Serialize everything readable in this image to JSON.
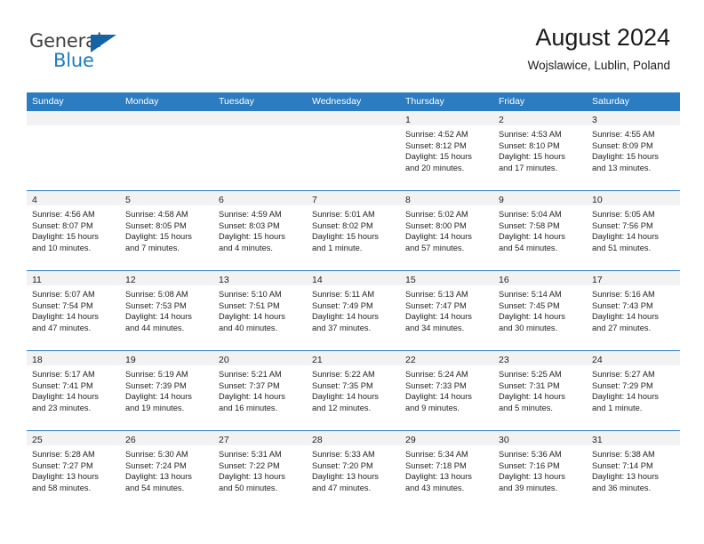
{
  "brand": {
    "name_top": "General",
    "name_bottom": "Blue",
    "triangle_icon": "blue-triangle-icon",
    "color_top": "#3f3f3f",
    "color_bottom": "#1b7bc1"
  },
  "header": {
    "title": "August 2024",
    "subtitle": "Wojslawice, Lublin, Poland"
  },
  "theme": {
    "header_blue": "#2b7cc0",
    "daynum_band": "#f2f2f2",
    "text": "#231f20"
  },
  "weekdays": [
    "Sunday",
    "Monday",
    "Tuesday",
    "Wednesday",
    "Thursday",
    "Friday",
    "Saturday"
  ],
  "weeks": [
    [
      {
        "day": "",
        "lines": []
      },
      {
        "day": "",
        "lines": []
      },
      {
        "day": "",
        "lines": []
      },
      {
        "day": "",
        "lines": []
      },
      {
        "day": "1",
        "lines": [
          "Sunrise: 4:52 AM",
          "Sunset: 8:12 PM",
          "Daylight: 15 hours",
          "and 20 minutes."
        ]
      },
      {
        "day": "2",
        "lines": [
          "Sunrise: 4:53 AM",
          "Sunset: 8:10 PM",
          "Daylight: 15 hours",
          "and 17 minutes."
        ]
      },
      {
        "day": "3",
        "lines": [
          "Sunrise: 4:55 AM",
          "Sunset: 8:09 PM",
          "Daylight: 15 hours",
          "and 13 minutes."
        ]
      }
    ],
    [
      {
        "day": "4",
        "lines": [
          "Sunrise: 4:56 AM",
          "Sunset: 8:07 PM",
          "Daylight: 15 hours",
          "and 10 minutes."
        ]
      },
      {
        "day": "5",
        "lines": [
          "Sunrise: 4:58 AM",
          "Sunset: 8:05 PM",
          "Daylight: 15 hours",
          "and 7 minutes."
        ]
      },
      {
        "day": "6",
        "lines": [
          "Sunrise: 4:59 AM",
          "Sunset: 8:03 PM",
          "Daylight: 15 hours",
          "and 4 minutes."
        ]
      },
      {
        "day": "7",
        "lines": [
          "Sunrise: 5:01 AM",
          "Sunset: 8:02 PM",
          "Daylight: 15 hours",
          "and 1 minute."
        ]
      },
      {
        "day": "8",
        "lines": [
          "Sunrise: 5:02 AM",
          "Sunset: 8:00 PM",
          "Daylight: 14 hours",
          "and 57 minutes."
        ]
      },
      {
        "day": "9",
        "lines": [
          "Sunrise: 5:04 AM",
          "Sunset: 7:58 PM",
          "Daylight: 14 hours",
          "and 54 minutes."
        ]
      },
      {
        "day": "10",
        "lines": [
          "Sunrise: 5:05 AM",
          "Sunset: 7:56 PM",
          "Daylight: 14 hours",
          "and 51 minutes."
        ]
      }
    ],
    [
      {
        "day": "11",
        "lines": [
          "Sunrise: 5:07 AM",
          "Sunset: 7:54 PM",
          "Daylight: 14 hours",
          "and 47 minutes."
        ]
      },
      {
        "day": "12",
        "lines": [
          "Sunrise: 5:08 AM",
          "Sunset: 7:53 PM",
          "Daylight: 14 hours",
          "and 44 minutes."
        ]
      },
      {
        "day": "13",
        "lines": [
          "Sunrise: 5:10 AM",
          "Sunset: 7:51 PM",
          "Daylight: 14 hours",
          "and 40 minutes."
        ]
      },
      {
        "day": "14",
        "lines": [
          "Sunrise: 5:11 AM",
          "Sunset: 7:49 PM",
          "Daylight: 14 hours",
          "and 37 minutes."
        ]
      },
      {
        "day": "15",
        "lines": [
          "Sunrise: 5:13 AM",
          "Sunset: 7:47 PM",
          "Daylight: 14 hours",
          "and 34 minutes."
        ]
      },
      {
        "day": "16",
        "lines": [
          "Sunrise: 5:14 AM",
          "Sunset: 7:45 PM",
          "Daylight: 14 hours",
          "and 30 minutes."
        ]
      },
      {
        "day": "17",
        "lines": [
          "Sunrise: 5:16 AM",
          "Sunset: 7:43 PM",
          "Daylight: 14 hours",
          "and 27 minutes."
        ]
      }
    ],
    [
      {
        "day": "18",
        "lines": [
          "Sunrise: 5:17 AM",
          "Sunset: 7:41 PM",
          "Daylight: 14 hours",
          "and 23 minutes."
        ]
      },
      {
        "day": "19",
        "lines": [
          "Sunrise: 5:19 AM",
          "Sunset: 7:39 PM",
          "Daylight: 14 hours",
          "and 19 minutes."
        ]
      },
      {
        "day": "20",
        "lines": [
          "Sunrise: 5:21 AM",
          "Sunset: 7:37 PM",
          "Daylight: 14 hours",
          "and 16 minutes."
        ]
      },
      {
        "day": "21",
        "lines": [
          "Sunrise: 5:22 AM",
          "Sunset: 7:35 PM",
          "Daylight: 14 hours",
          "and 12 minutes."
        ]
      },
      {
        "day": "22",
        "lines": [
          "Sunrise: 5:24 AM",
          "Sunset: 7:33 PM",
          "Daylight: 14 hours",
          "and 9 minutes."
        ]
      },
      {
        "day": "23",
        "lines": [
          "Sunrise: 5:25 AM",
          "Sunset: 7:31 PM",
          "Daylight: 14 hours",
          "and 5 minutes."
        ]
      },
      {
        "day": "24",
        "lines": [
          "Sunrise: 5:27 AM",
          "Sunset: 7:29 PM",
          "Daylight: 14 hours",
          "and 1 minute."
        ]
      }
    ],
    [
      {
        "day": "25",
        "lines": [
          "Sunrise: 5:28 AM",
          "Sunset: 7:27 PM",
          "Daylight: 13 hours",
          "and 58 minutes."
        ]
      },
      {
        "day": "26",
        "lines": [
          "Sunrise: 5:30 AM",
          "Sunset: 7:24 PM",
          "Daylight: 13 hours",
          "and 54 minutes."
        ]
      },
      {
        "day": "27",
        "lines": [
          "Sunrise: 5:31 AM",
          "Sunset: 7:22 PM",
          "Daylight: 13 hours",
          "and 50 minutes."
        ]
      },
      {
        "day": "28",
        "lines": [
          "Sunrise: 5:33 AM",
          "Sunset: 7:20 PM",
          "Daylight: 13 hours",
          "and 47 minutes."
        ]
      },
      {
        "day": "29",
        "lines": [
          "Sunrise: 5:34 AM",
          "Sunset: 7:18 PM",
          "Daylight: 13 hours",
          "and 43 minutes."
        ]
      },
      {
        "day": "30",
        "lines": [
          "Sunrise: 5:36 AM",
          "Sunset: 7:16 PM",
          "Daylight: 13 hours",
          "and 39 minutes."
        ]
      },
      {
        "day": "31",
        "lines": [
          "Sunrise: 5:38 AM",
          "Sunset: 7:14 PM",
          "Daylight: 13 hours",
          "and 36 minutes."
        ]
      }
    ]
  ]
}
